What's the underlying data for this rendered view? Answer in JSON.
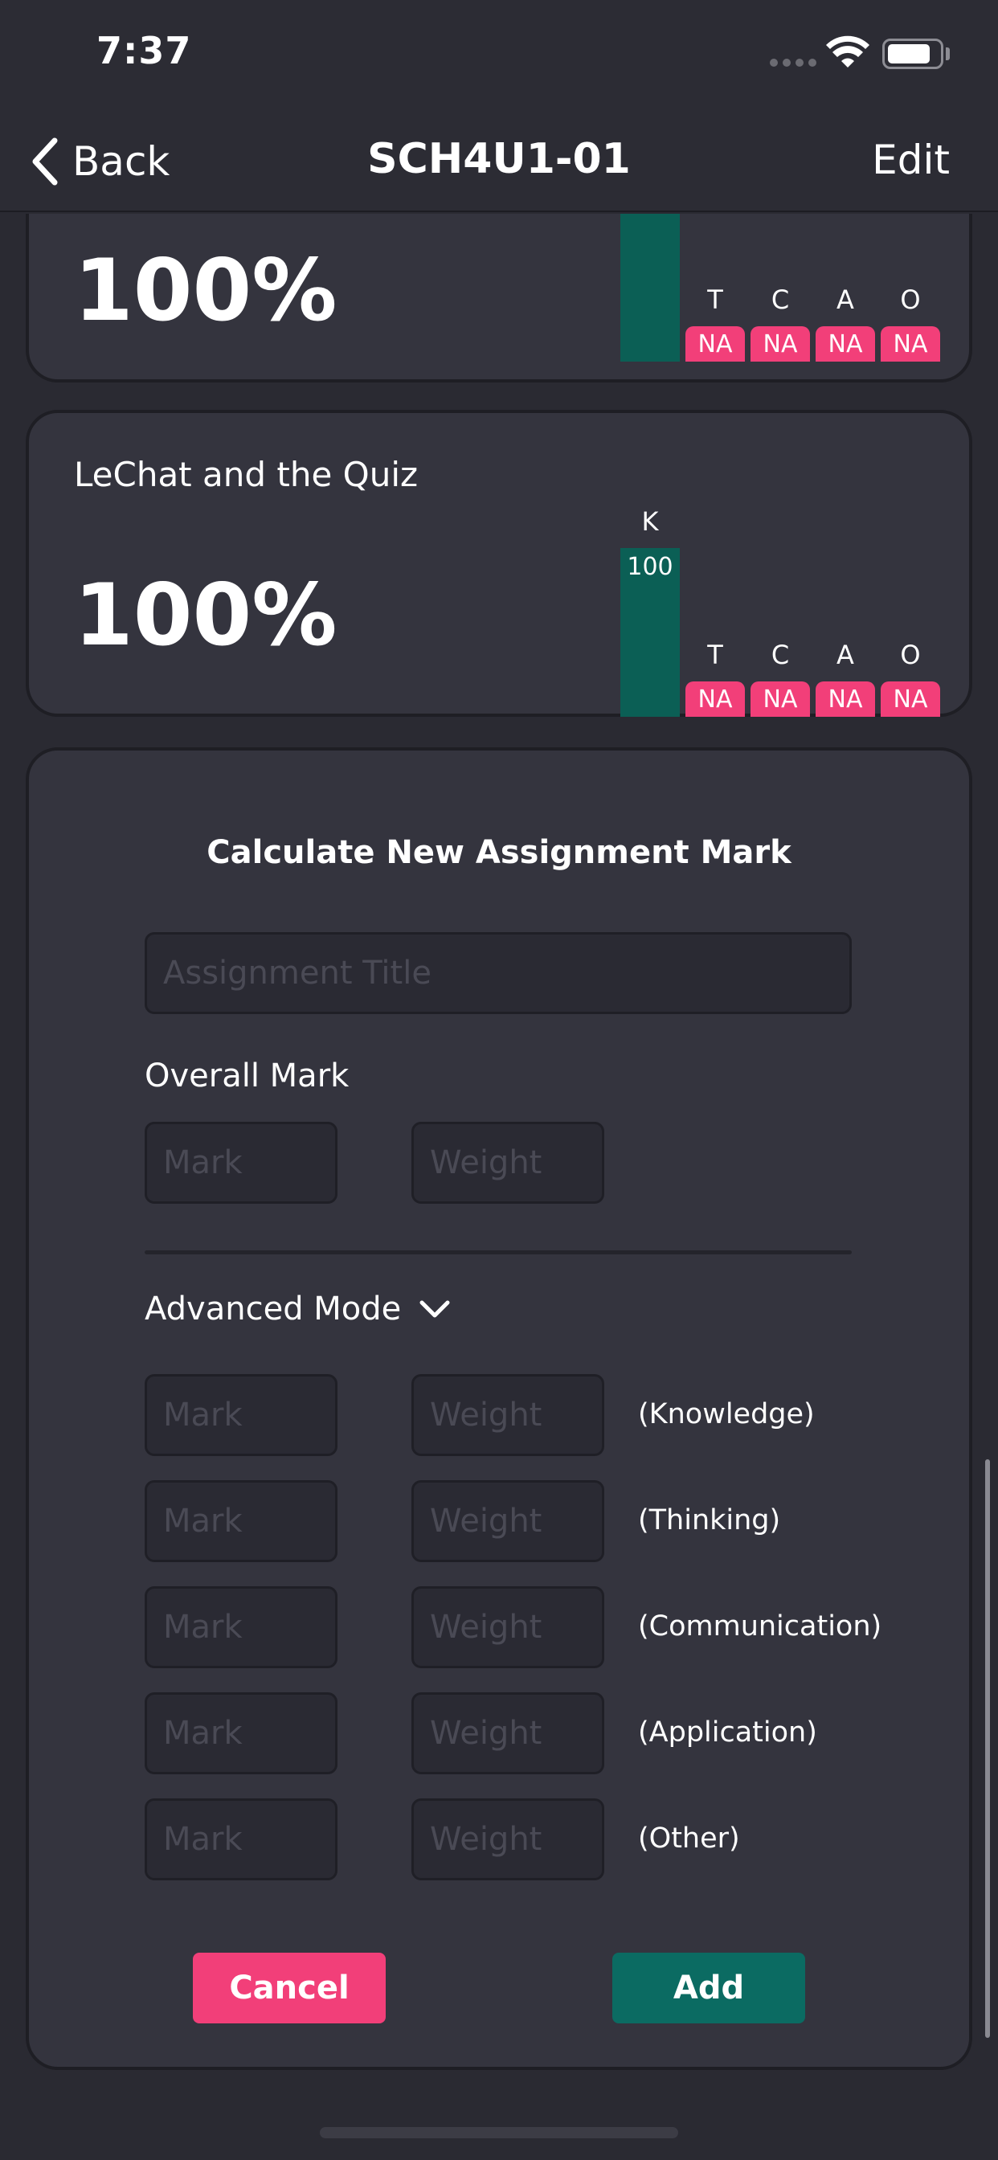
{
  "status_bar": {
    "time": "7:37"
  },
  "nav": {
    "back_label": "Back",
    "title": "SCH4U1-01",
    "edit_label": "Edit"
  },
  "cards": [
    {
      "title": "",
      "percent": "100%",
      "k_value": "100",
      "letters": [
        "T",
        "C",
        "A",
        "O"
      ],
      "na": [
        "NA",
        "NA",
        "NA",
        "NA"
      ]
    },
    {
      "title": "LeChat and the Quiz",
      "percent": "100%",
      "k_letter": "K",
      "k_value": "100",
      "letters": [
        "T",
        "C",
        "A",
        "O"
      ],
      "na": [
        "NA",
        "NA",
        "NA",
        "NA"
      ]
    }
  ],
  "form": {
    "heading": "Calculate New Assignment Mark",
    "title_placeholder": "Assignment Title",
    "overall_label": "Overall Mark",
    "mark_placeholder": "Mark",
    "weight_placeholder": "Weight",
    "advanced_label": "Advanced Mode",
    "categories": [
      "(Knowledge)",
      "(Thinking)",
      "(Communication)",
      "(Application)",
      "(Other)"
    ],
    "cancel_label": "Cancel",
    "add_label": "Add"
  },
  "colors": {
    "accent_pink": "#f23f79",
    "accent_teal": "#0b6b62",
    "bar_teal": "#0b5f55",
    "background": "#2a2a32",
    "card": "#34343e"
  },
  "icons": [
    "back-chevron-icon",
    "wifi-icon",
    "battery-icon",
    "chevron-down-icon"
  ]
}
